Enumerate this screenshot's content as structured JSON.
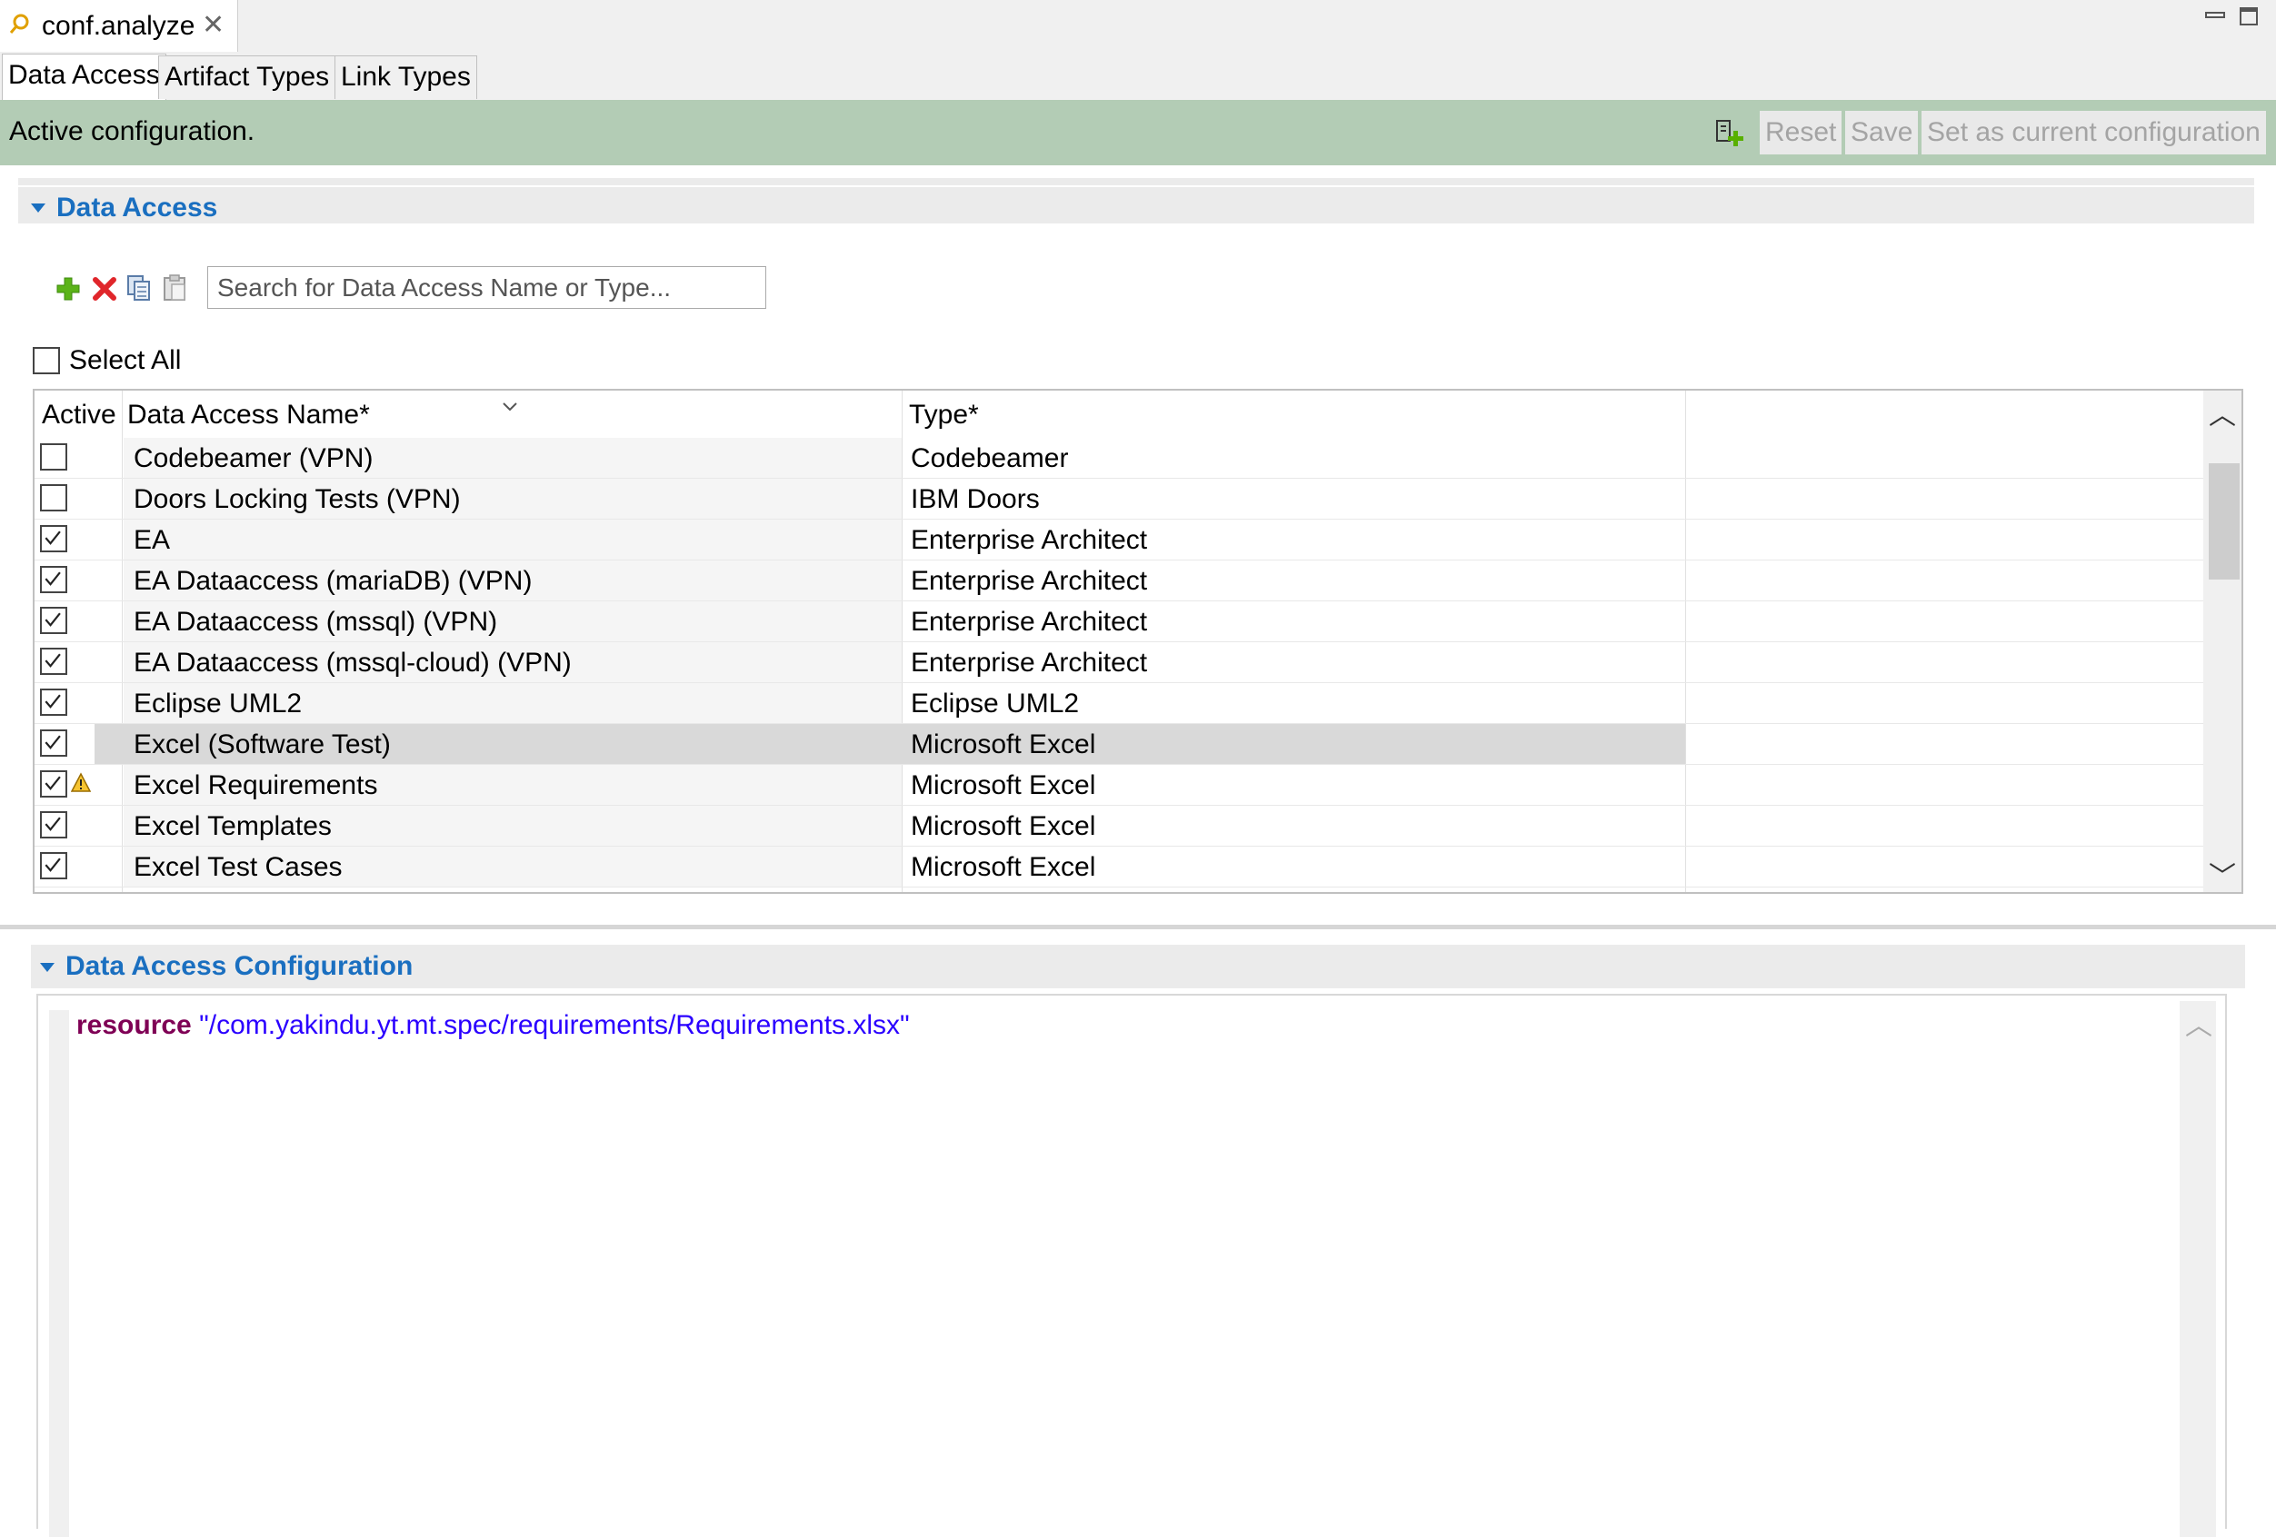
{
  "editor": {
    "tab_title": "conf.analyze",
    "close_glyph": "✕"
  },
  "page_tabs": [
    {
      "label": "Data Access",
      "active": true
    },
    {
      "label": "Artifact Types",
      "active": false
    },
    {
      "label": "Link Types",
      "active": false
    }
  ],
  "status": {
    "message": "Active configuration.",
    "reset_label": "Reset",
    "save_label": "Save",
    "set_current_label": "Set as current configuration",
    "banner_color": "#b3ccb5"
  },
  "data_access_section": {
    "title": "Data Access",
    "toolbar_icons": [
      "add-icon",
      "delete-icon",
      "copy-icon",
      "paste-icon"
    ],
    "search_placeholder": "Search for Data Access Name or Type...",
    "select_all_label": "Select All",
    "columns": {
      "active": "Active",
      "name": "Data Access Name*",
      "type": "Type*"
    },
    "rows": [
      {
        "checked": false,
        "name": "Codebeamer (VPN)",
        "type": "Codebeamer",
        "warning": false,
        "selected": false
      },
      {
        "checked": false,
        "name": "Doors Locking Tests (VPN)",
        "type": "IBM Doors",
        "warning": false,
        "selected": false
      },
      {
        "checked": true,
        "name": "EA",
        "type": "Enterprise Architect",
        "warning": false,
        "selected": false
      },
      {
        "checked": true,
        "name": "EA Dataaccess (mariaDB) (VPN)",
        "type": "Enterprise Architect",
        "warning": false,
        "selected": false
      },
      {
        "checked": true,
        "name": "EA Dataaccess (mssql) (VPN)",
        "type": "Enterprise Architect",
        "warning": false,
        "selected": false
      },
      {
        "checked": true,
        "name": "EA Dataaccess (mssql-cloud) (VPN)",
        "type": "Enterprise Architect",
        "warning": false,
        "selected": false
      },
      {
        "checked": true,
        "name": "Eclipse UML2",
        "type": "Eclipse UML2",
        "warning": false,
        "selected": false
      },
      {
        "checked": true,
        "name": "Excel (Software Test)",
        "type": "Microsoft Excel",
        "warning": false,
        "selected": true
      },
      {
        "checked": true,
        "name": "Excel Requirements",
        "type": "Microsoft Excel",
        "warning": true,
        "selected": false
      },
      {
        "checked": true,
        "name": "Excel Templates",
        "type": "Microsoft Excel",
        "warning": false,
        "selected": false
      },
      {
        "checked": true,
        "name": "Excel Test Cases",
        "type": "Microsoft Excel",
        "warning": false,
        "selected": false
      }
    ]
  },
  "config_section": {
    "title": "Data Access Configuration",
    "keyword": "resource",
    "value": "\"/com.yakindu.yt.mt.spec/requirements/Requirements.xlsx\"",
    "keyword_color": "#7f0055",
    "string_color": "#2a00ff"
  },
  "colors": {
    "section_title": "#1a6fc0",
    "selected_row": "#d9d9d9"
  }
}
